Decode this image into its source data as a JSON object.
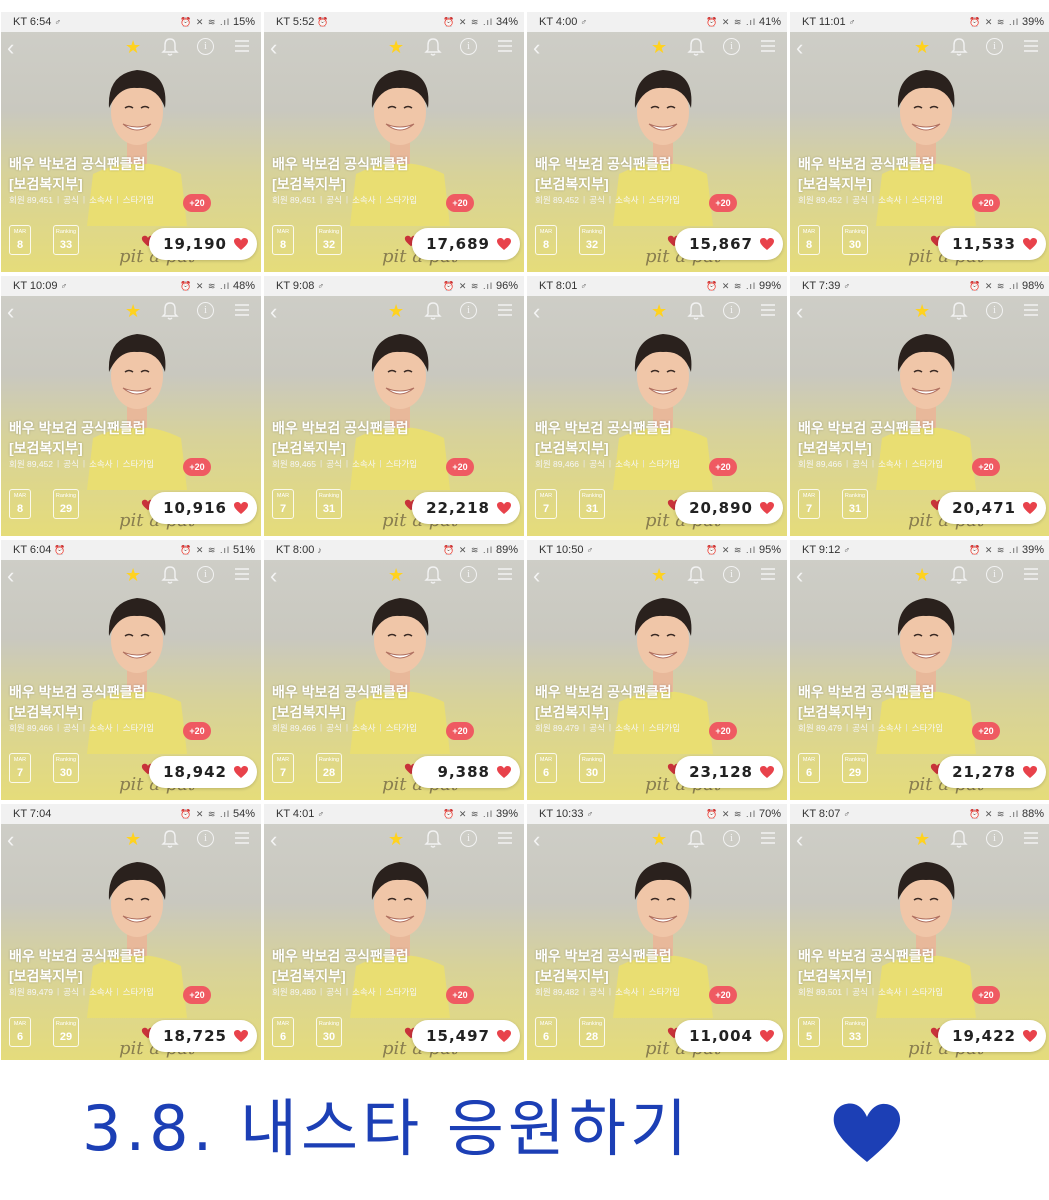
{
  "common": {
    "title_line1": "배우 박보검 공식팬클럽",
    "title_line2": "[보검복지부]",
    "meta_official": "공식",
    "meta_agency": "소속사",
    "meta_star": "스타가입",
    "plus_label": "+20",
    "mar_label": "MAR",
    "rank_label": "Ranking",
    "signature": "pit a pat",
    "icons": {
      "back": "back-arrow-icon",
      "star": "favorite-star-icon",
      "bell": "bell-icon",
      "info": "info-icon",
      "menu": "menu-icon",
      "heart": "heart-icon"
    },
    "colors": {
      "heart": "#e8424b",
      "plus_badge": "#ef5a62",
      "star": "#ffd21f",
      "caption": "#1c3fb5"
    }
  },
  "tiles": [
    {
      "time": "KT 6:54",
      "status_glyph": "♂",
      "battery": "15%",
      "members": "회원 89,451",
      "mar": "8",
      "rank": "33",
      "votes": "19,190"
    },
    {
      "time": "KT 5:52",
      "status_glyph": "⏰",
      "battery": "34%",
      "members": "회원 89,451",
      "mar": "8",
      "rank": "32",
      "votes": "17,689"
    },
    {
      "time": "KT 4:00",
      "status_glyph": "♂",
      "battery": "41%",
      "members": "회원 89,452",
      "mar": "8",
      "rank": "32",
      "votes": "15,867"
    },
    {
      "time": "KT 11:01",
      "status_glyph": "♂",
      "battery": "39%",
      "members": "회원 89,452",
      "mar": "8",
      "rank": "30",
      "votes": "11,533"
    },
    {
      "time": "KT 10:09",
      "status_glyph": "♂",
      "battery": "48%",
      "members": "회원 89,452",
      "mar": "8",
      "rank": "29",
      "votes": "10,916"
    },
    {
      "time": "KT 9:08",
      "status_glyph": "♂",
      "battery": "96%",
      "members": "회원 89,465",
      "mar": "7",
      "rank": "31",
      "votes": "22,218"
    },
    {
      "time": "KT 8:01",
      "status_glyph": "♂",
      "battery": "99%",
      "members": "회원 89,466",
      "mar": "7",
      "rank": "31",
      "votes": "20,890"
    },
    {
      "time": "KT 7:39",
      "status_glyph": "♂",
      "battery": "98%",
      "members": "회원 89,466",
      "mar": "7",
      "rank": "31",
      "votes": "20,471"
    },
    {
      "time": "KT 6:04",
      "status_glyph": "⏰",
      "battery": "51%",
      "members": "회원 89,466",
      "mar": "7",
      "rank": "30",
      "votes": "18,942"
    },
    {
      "time": "KT 8:00",
      "status_glyph": "♪",
      "battery": "89%",
      "members": "회원 89,466",
      "mar": "7",
      "rank": "28",
      "votes": "9,388"
    },
    {
      "time": "KT 10:50",
      "status_glyph": "♂",
      "battery": "95%",
      "members": "회원 89,479",
      "mar": "6",
      "rank": "30",
      "votes": "23,128"
    },
    {
      "time": "KT 9:12",
      "status_glyph": "♂",
      "battery": "39%",
      "members": "회원 89,479",
      "mar": "6",
      "rank": "29",
      "votes": "21,278"
    },
    {
      "time": "KT 7:04",
      "status_glyph": "",
      "battery": "54%",
      "members": "회원 89,479",
      "mar": "6",
      "rank": "29",
      "votes": "18,725"
    },
    {
      "time": "KT 4:01",
      "status_glyph": "♂",
      "battery": "39%",
      "members": "회원 89,480",
      "mar": "6",
      "rank": "30",
      "votes": "15,497"
    },
    {
      "time": "KT 10:33",
      "status_glyph": "♂",
      "battery": "70%",
      "members": "회원 89,482",
      "mar": "6",
      "rank": "28",
      "votes": "11,004"
    },
    {
      "time": "KT 8:07",
      "status_glyph": "♂",
      "battery": "88%",
      "members": "회원 89,501",
      "mar": "5",
      "rank": "33",
      "votes": "19,422"
    }
  ],
  "caption": "3.8. 내스타 응원하기"
}
